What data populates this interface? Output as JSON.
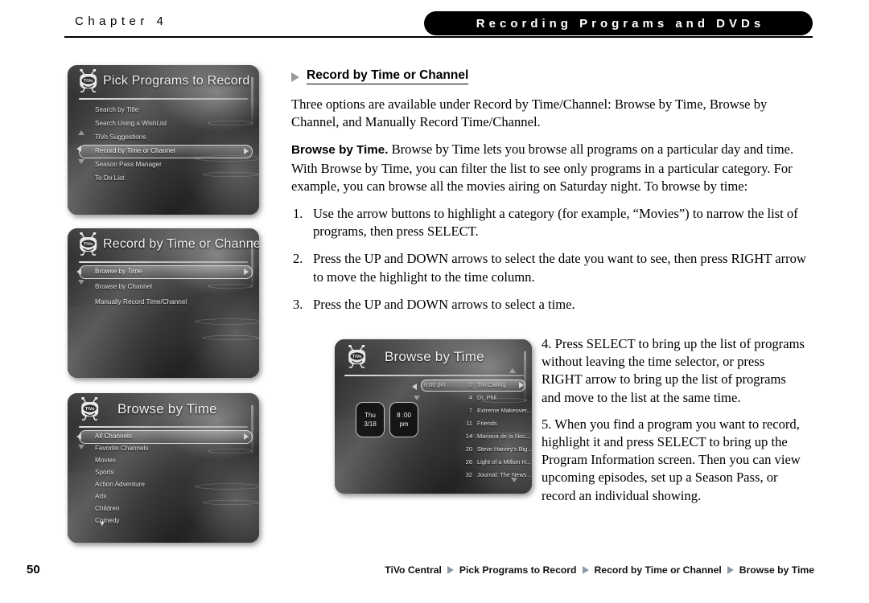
{
  "header": {
    "chapter": "Chapter 4",
    "title": "Recording Programs and DVDs"
  },
  "section": {
    "heading": "Record by Time or Channel",
    "intro": "Three options are available under Record by Time/Channel: Browse by Time, Browse by Channel, and Manually Record Time/Channel.",
    "browse_lead": "Browse by Time.",
    "browse_body": "Browse by Time lets you browse all programs on a particular day and time. With Browse by Time, you can filter the list to see only programs in a particular category. For example, you can browse all the movies airing on Saturday night. To browse by time:",
    "steps": [
      {
        "num": "1.",
        "text": "Use the arrow buttons to highlight a category (for example, “Movies”) to narrow the list of programs, then press SELECT."
      },
      {
        "num": "2.",
        "text": "Press the UP and DOWN arrows to select the date you want to see, then press RIGHT arrow to move the highlight to the time column."
      },
      {
        "num": "3.",
        "text": "Press the UP and DOWN arrows to select a time."
      }
    ],
    "steps_right": [
      {
        "text": "4. Press SELECT to bring up the list of programs without leaving the time selector, or press RIGHT arrow to bring up the list of programs and move to the list at the same time."
      },
      {
        "text": "5. When you find a program you want to record, highlight it and press SELECT to bring up the Program Information screen. Then you can view upcoming episodes, set up a Season Pass, or record an individual showing."
      }
    ]
  },
  "screens": {
    "pick_programs": {
      "title": "Pick Programs to Record",
      "items": [
        {
          "label": "Search by Title",
          "selected": false
        },
        {
          "label": "Search Using a WishList",
          "selected": false
        },
        {
          "label": "TiVo Suggestions",
          "selected": false
        },
        {
          "label": "Record by Time or Channel",
          "selected": true
        },
        {
          "label": "Season Pass Manager",
          "selected": false
        },
        {
          "label": "To Do List",
          "selected": false
        }
      ]
    },
    "record_by_time": {
      "title": "Record by Time or Channel",
      "items": [
        {
          "label": "Browse by Time",
          "selected": true
        },
        {
          "label": "Browse by Channel",
          "selected": false
        },
        {
          "label": "Manually Record Time/Channel",
          "selected": false
        }
      ]
    },
    "browse_by_time_categories": {
      "title": "Browse by Time",
      "items": [
        {
          "label": "All Channels",
          "selected": true
        },
        {
          "label": "Favorite Channels",
          "selected": false
        },
        {
          "label": "Movies",
          "selected": false
        },
        {
          "label": "Sports",
          "selected": false
        },
        {
          "label": "Action Adventure",
          "selected": false
        },
        {
          "label": "Arts",
          "selected": false
        },
        {
          "label": "Children",
          "selected": false
        },
        {
          "label": "Comedy",
          "selected": false
        }
      ],
      "more_indicator": "▼"
    },
    "browse_by_time_grid": {
      "title": "Browse by Time",
      "date_box": {
        "day": "Thu",
        "date": "3/18"
      },
      "time_box": {
        "hour": "8 :00",
        "meridiem": "pm"
      },
      "time_label": "8:00 pm",
      "listings": [
        {
          "channel": "2",
          "program": "Tru Calling",
          "selected": true
        },
        {
          "channel": "4",
          "program": "Dr. Phil",
          "selected": false
        },
        {
          "channel": "7",
          "program": "Extreme Makeover...",
          "selected": false
        },
        {
          "channel": "11",
          "program": "Friends",
          "selected": false
        },
        {
          "channel": "14",
          "program": "Mariana de la Noc...",
          "selected": false
        },
        {
          "channel": "20",
          "program": "Steve Harvey's Big ...",
          "selected": false
        },
        {
          "channel": "26",
          "program": "Light of a Million H...",
          "selected": false
        },
        {
          "channel": "32",
          "program": "Journal: The News ...",
          "selected": false
        }
      ]
    }
  },
  "footer": {
    "page_number": "50",
    "breadcrumb": [
      "TiVo Central",
      "Pick Programs to Record",
      "Record by Time or Channel",
      "Browse by Time"
    ]
  },
  "colors": {
    "accent_triangle": "#8d9aa5",
    "heading_bullet": "#9a9a9a",
    "header_pill_bg": "#000000"
  }
}
